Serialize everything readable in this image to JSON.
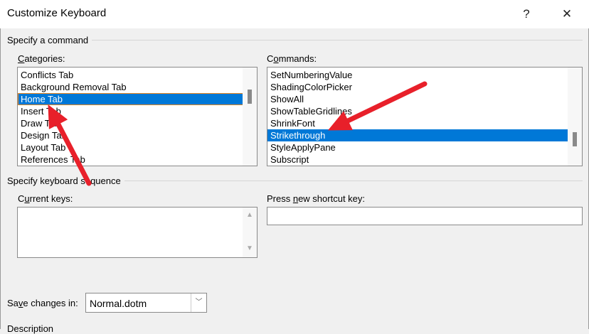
{
  "window": {
    "title": "Customize Keyboard",
    "help": "?",
    "close": "✕"
  },
  "specify_command": {
    "label": "Specify a command",
    "categories_label_pre": "",
    "categories_label_u": "C",
    "categories_label_post": "ategories:",
    "categories": [
      "Conflicts Tab",
      "Background Removal Tab",
      "Home Tab",
      "Insert Tab",
      "Draw Tab",
      "Design Tab",
      "Layout Tab",
      "References Tab"
    ],
    "selected_category": "Home Tab",
    "commands_label_pre": "C",
    "commands_label_u": "o",
    "commands_label_post": "mmands:",
    "commands": [
      "SetNumberingValue",
      "ShadingColorPicker",
      "ShowAll",
      "ShowTableGridlines",
      "ShrinkFont",
      "Strikethrough",
      "StyleApplyPane",
      "Subscript"
    ],
    "selected_command": "Strikethrough"
  },
  "keyboard_sequence": {
    "label": "Specify keyboard sequence",
    "current_keys_pre": "C",
    "current_keys_u": "u",
    "current_keys_post": "rrent keys:",
    "new_key_pre": "Press ",
    "new_key_u": "n",
    "new_key_post": "ew shortcut key:",
    "new_key_value": ""
  },
  "save": {
    "label_pre": "Sa",
    "label_u": "v",
    "label_post": "e changes in:",
    "value": "Normal.dotm"
  },
  "description_label": "Description",
  "annotation_color": "#e8202a"
}
